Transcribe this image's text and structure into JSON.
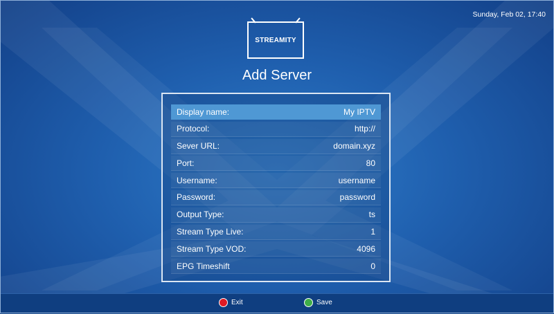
{
  "header": {
    "datetime": "Sunday, Feb 02, 17:40",
    "logo_text": "STREAMITY",
    "title": "Add Server"
  },
  "form": {
    "selected_index": 0,
    "rows": [
      {
        "label": "Display name:",
        "value": "My IPTV"
      },
      {
        "label": "Protocol:",
        "value": "http://"
      },
      {
        "label": "Sever URL:",
        "value": "domain.xyz"
      },
      {
        "label": "Port:",
        "value": "80"
      },
      {
        "label": "Username:",
        "value": "username"
      },
      {
        "label": "Password:",
        "value": "password"
      },
      {
        "label": "Output Type:",
        "value": "ts"
      },
      {
        "label": "Stream Type Live:",
        "value": "1"
      },
      {
        "label": "Stream Type VOD:",
        "value": "4096"
      },
      {
        "label": "EPG Timeshift",
        "value": "0"
      }
    ]
  },
  "footer": {
    "exit_label": "Exit",
    "save_label": "Save"
  },
  "colors": {
    "selected_row": "#4f98d4",
    "exit_button": "#e01b24",
    "save_button": "#3fae49"
  }
}
